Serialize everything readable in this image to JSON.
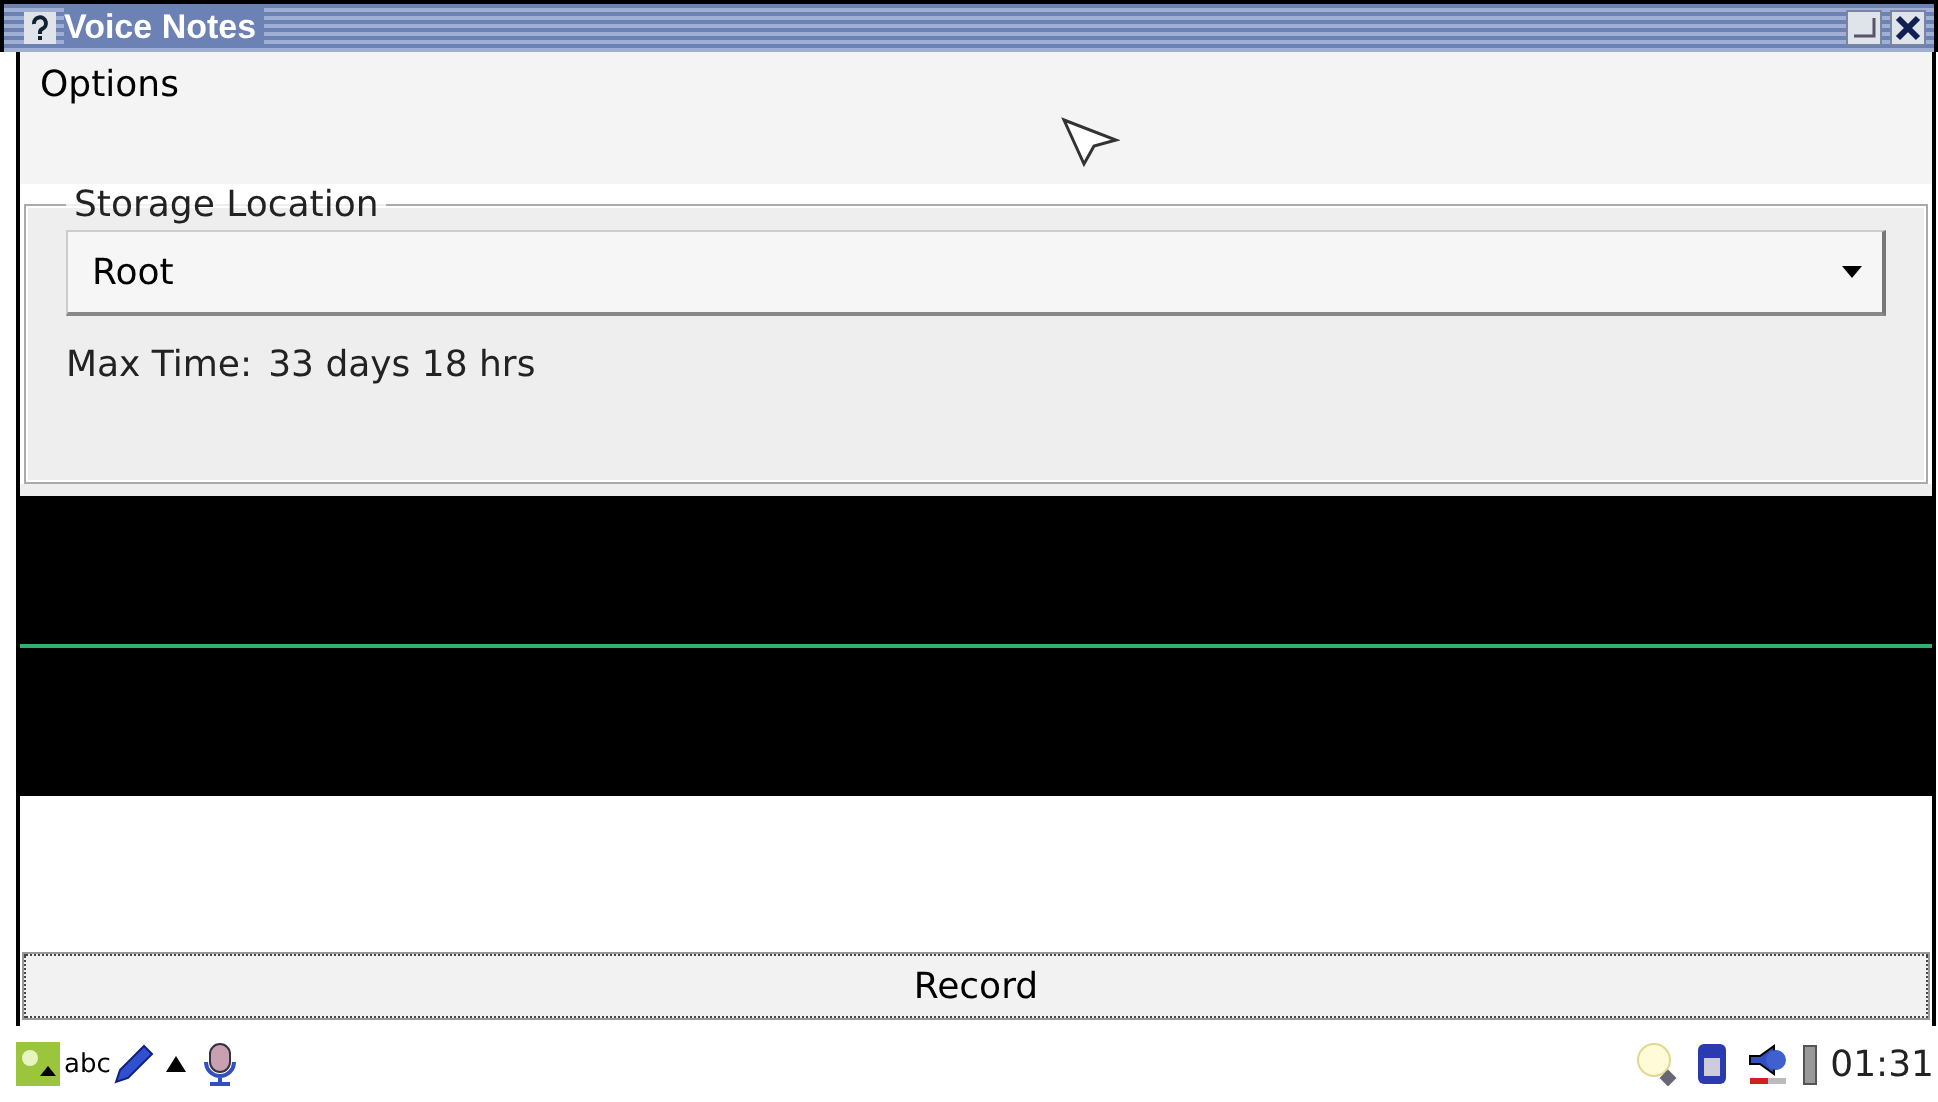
{
  "window": {
    "title": "Voice Notes"
  },
  "menu": [
    "Options"
  ],
  "storage": {
    "legend": "Storage Location",
    "location": "Root",
    "max_time_label": "Max Time:",
    "max_time_value": "33 days 18 hrs"
  },
  "record_button": "Record",
  "taskbar": {
    "abc": "abc",
    "clock": "01:31"
  }
}
